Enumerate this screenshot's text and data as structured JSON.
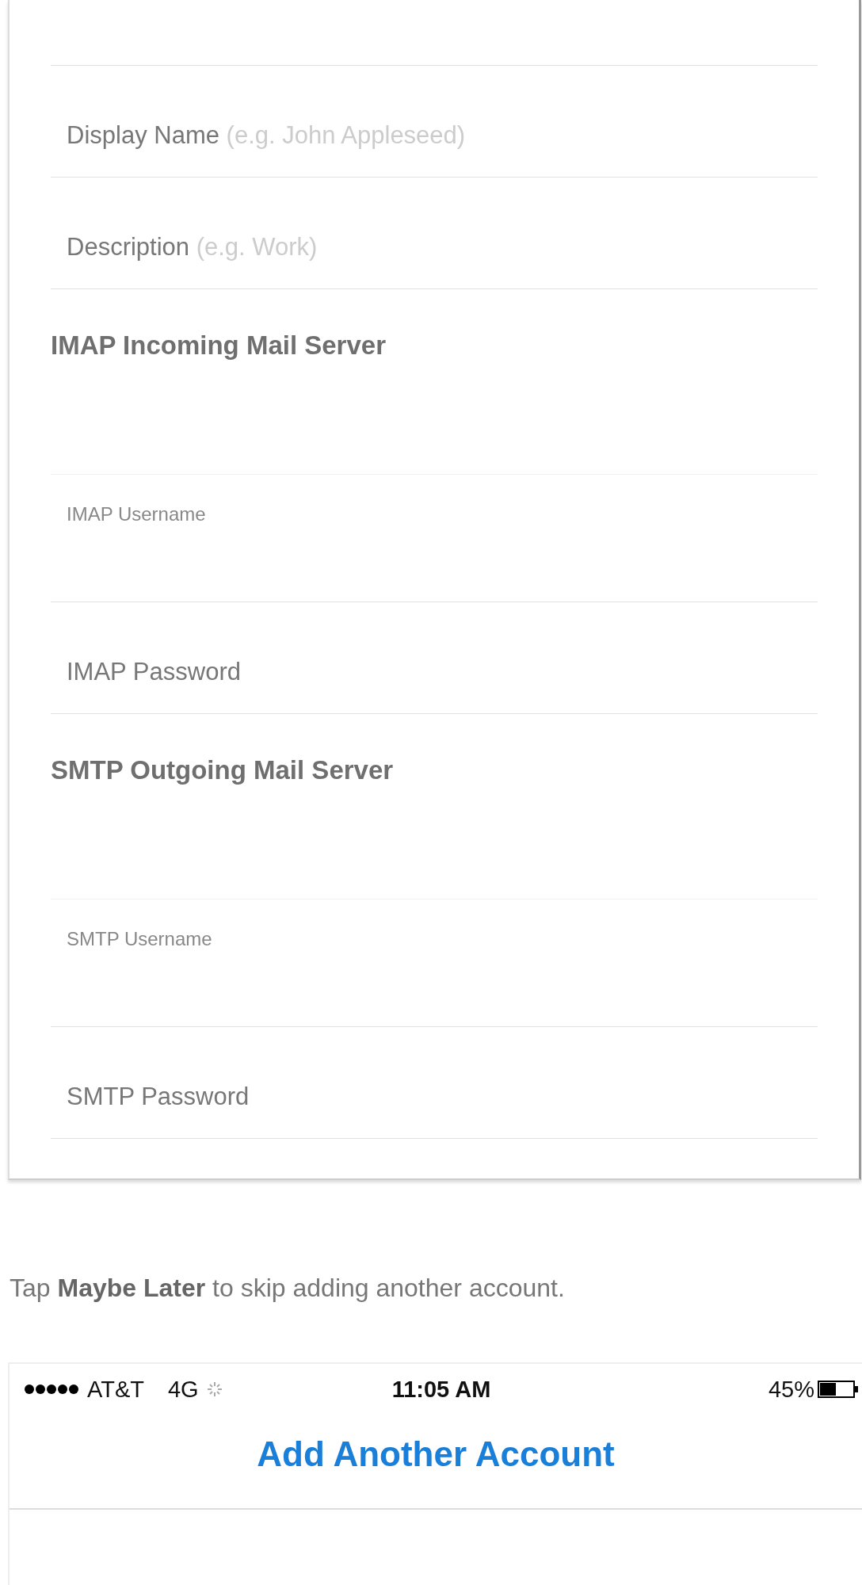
{
  "form": [
    {
      "kind": "field",
      "label": "Display Name",
      "placeholder": "(e.g. John Appleseed)"
    },
    {
      "kind": "field",
      "label": "Description",
      "placeholder": "(e.g. Work)"
    },
    {
      "kind": "header",
      "label": "IMAP Incoming Mail Server"
    },
    {
      "kind": "small",
      "label": "IMAP Username"
    },
    {
      "kind": "field",
      "label": "IMAP Password"
    },
    {
      "kind": "header",
      "label": "SMTP Outgoing Mail Server"
    },
    {
      "kind": "small",
      "label": "SMTP Username"
    },
    {
      "kind": "field",
      "label": "SMTP Password"
    }
  ],
  "instruction": "Tap **Maybe Later** to skip adding another account.",
  "phone": {
    "carrier": "AT&T",
    "network": "4G",
    "time": "11:05 AM",
    "battery": "45%",
    "title": "Add Another Account"
  }
}
